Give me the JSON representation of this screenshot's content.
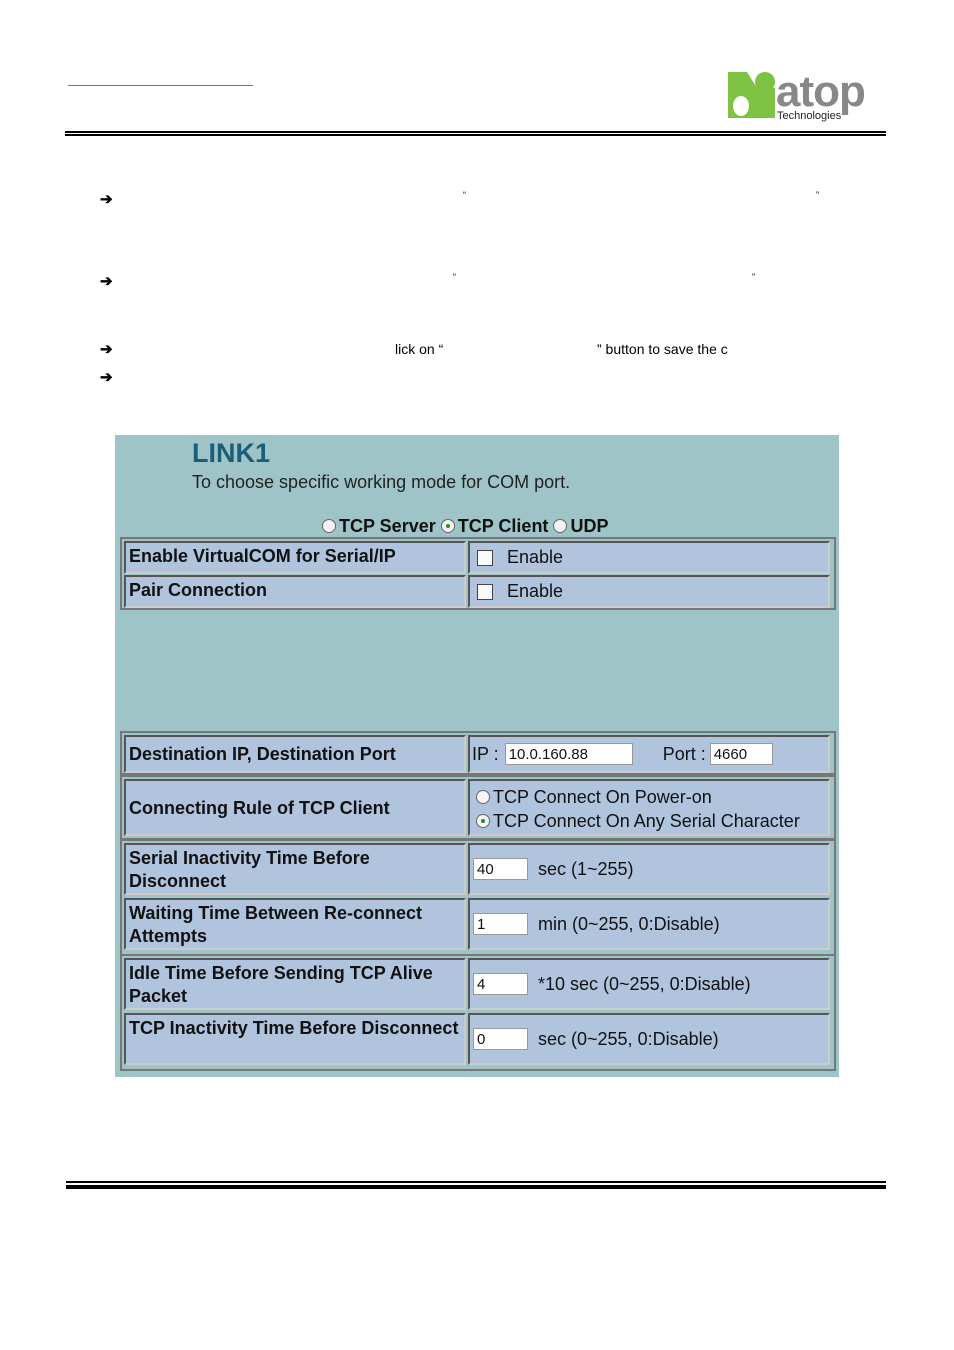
{
  "header": {
    "logo_text": "atop",
    "logo_subtext": "Technologies",
    "logo_color": "#7dc242"
  },
  "bullets": [
    {
      "icon": "arrow-right-icon",
      "open_quote": "“",
      "close_quote": "”"
    },
    {
      "icon": "arrow-right-icon",
      "open_quote": "“",
      "close_quote": "”"
    },
    {
      "icon": "arrow-right-icon",
      "text_before": "lick on “",
      "text_after": "” button to save the c"
    },
    {
      "icon": "arrow-right-icon"
    }
  ],
  "screenshot": {
    "title": "LINK1",
    "subtitle": "To choose specific working mode for COM port.",
    "modes": [
      {
        "label": "TCP Server",
        "selected": false
      },
      {
        "label": "TCP Client",
        "selected": true
      },
      {
        "label": "UDP",
        "selected": false
      }
    ],
    "rows": {
      "virtualcom": {
        "label": "Enable VirtualCOM for Serial/IP",
        "option": "Enable",
        "checked": false
      },
      "pair": {
        "label": "Pair Connection",
        "option": "Enable",
        "checked": false
      },
      "dest": {
        "label": "Destination IP, Destination Port",
        "ip_label": "IP :",
        "ip": "10.0.160.88",
        "port_label": "Port :",
        "port": "4660"
      },
      "rule": {
        "label": "Connecting Rule of TCP Client",
        "options": [
          {
            "label": "TCP Connect On Power-on",
            "selected": false
          },
          {
            "label": "TCP Connect On Any Serial Character",
            "selected": true
          }
        ]
      },
      "serial": {
        "label": "Serial Inactivity Time Before Disconnect",
        "value": "40",
        "unit": "sec (1~255)"
      },
      "waiting": {
        "label": "Waiting Time Between Re-connect Attempts",
        "value": "1",
        "unit": "min (0~255, 0:Disable)"
      },
      "idle": {
        "label": "Idle Time Before Sending TCP Alive Packet",
        "value": "4",
        "unit": "*10 sec (0~255, 0:Disable)"
      },
      "inact": {
        "label": "TCP Inactivity Time Before Disconnect",
        "value": "0",
        "unit": "sec (0~255, 0:Disable)"
      }
    }
  }
}
